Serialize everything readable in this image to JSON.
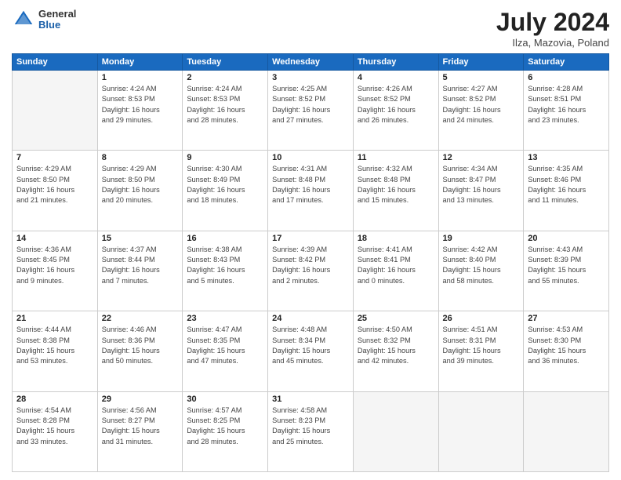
{
  "header": {
    "logo_general": "General",
    "logo_blue": "Blue",
    "title": "July 2024",
    "location": "Ilza, Mazovia, Poland"
  },
  "days_of_week": [
    "Sunday",
    "Monday",
    "Tuesday",
    "Wednesday",
    "Thursday",
    "Friday",
    "Saturday"
  ],
  "weeks": [
    [
      {
        "day": "",
        "info": "",
        "empty": true
      },
      {
        "day": "1",
        "info": "Sunrise: 4:24 AM\nSunset: 8:53 PM\nDaylight: 16 hours\nand 29 minutes."
      },
      {
        "day": "2",
        "info": "Sunrise: 4:24 AM\nSunset: 8:53 PM\nDaylight: 16 hours\nand 28 minutes."
      },
      {
        "day": "3",
        "info": "Sunrise: 4:25 AM\nSunset: 8:52 PM\nDaylight: 16 hours\nand 27 minutes."
      },
      {
        "day": "4",
        "info": "Sunrise: 4:26 AM\nSunset: 8:52 PM\nDaylight: 16 hours\nand 26 minutes."
      },
      {
        "day": "5",
        "info": "Sunrise: 4:27 AM\nSunset: 8:52 PM\nDaylight: 16 hours\nand 24 minutes."
      },
      {
        "day": "6",
        "info": "Sunrise: 4:28 AM\nSunset: 8:51 PM\nDaylight: 16 hours\nand 23 minutes."
      }
    ],
    [
      {
        "day": "7",
        "info": "Sunrise: 4:29 AM\nSunset: 8:50 PM\nDaylight: 16 hours\nand 21 minutes."
      },
      {
        "day": "8",
        "info": "Sunrise: 4:29 AM\nSunset: 8:50 PM\nDaylight: 16 hours\nand 20 minutes."
      },
      {
        "day": "9",
        "info": "Sunrise: 4:30 AM\nSunset: 8:49 PM\nDaylight: 16 hours\nand 18 minutes."
      },
      {
        "day": "10",
        "info": "Sunrise: 4:31 AM\nSunset: 8:48 PM\nDaylight: 16 hours\nand 17 minutes."
      },
      {
        "day": "11",
        "info": "Sunrise: 4:32 AM\nSunset: 8:48 PM\nDaylight: 16 hours\nand 15 minutes."
      },
      {
        "day": "12",
        "info": "Sunrise: 4:34 AM\nSunset: 8:47 PM\nDaylight: 16 hours\nand 13 minutes."
      },
      {
        "day": "13",
        "info": "Sunrise: 4:35 AM\nSunset: 8:46 PM\nDaylight: 16 hours\nand 11 minutes."
      }
    ],
    [
      {
        "day": "14",
        "info": "Sunrise: 4:36 AM\nSunset: 8:45 PM\nDaylight: 16 hours\nand 9 minutes."
      },
      {
        "day": "15",
        "info": "Sunrise: 4:37 AM\nSunset: 8:44 PM\nDaylight: 16 hours\nand 7 minutes."
      },
      {
        "day": "16",
        "info": "Sunrise: 4:38 AM\nSunset: 8:43 PM\nDaylight: 16 hours\nand 5 minutes."
      },
      {
        "day": "17",
        "info": "Sunrise: 4:39 AM\nSunset: 8:42 PM\nDaylight: 16 hours\nand 2 minutes."
      },
      {
        "day": "18",
        "info": "Sunrise: 4:41 AM\nSunset: 8:41 PM\nDaylight: 16 hours\nand 0 minutes."
      },
      {
        "day": "19",
        "info": "Sunrise: 4:42 AM\nSunset: 8:40 PM\nDaylight: 15 hours\nand 58 minutes."
      },
      {
        "day": "20",
        "info": "Sunrise: 4:43 AM\nSunset: 8:39 PM\nDaylight: 15 hours\nand 55 minutes."
      }
    ],
    [
      {
        "day": "21",
        "info": "Sunrise: 4:44 AM\nSunset: 8:38 PM\nDaylight: 15 hours\nand 53 minutes."
      },
      {
        "day": "22",
        "info": "Sunrise: 4:46 AM\nSunset: 8:36 PM\nDaylight: 15 hours\nand 50 minutes."
      },
      {
        "day": "23",
        "info": "Sunrise: 4:47 AM\nSunset: 8:35 PM\nDaylight: 15 hours\nand 47 minutes."
      },
      {
        "day": "24",
        "info": "Sunrise: 4:48 AM\nSunset: 8:34 PM\nDaylight: 15 hours\nand 45 minutes."
      },
      {
        "day": "25",
        "info": "Sunrise: 4:50 AM\nSunset: 8:32 PM\nDaylight: 15 hours\nand 42 minutes."
      },
      {
        "day": "26",
        "info": "Sunrise: 4:51 AM\nSunset: 8:31 PM\nDaylight: 15 hours\nand 39 minutes."
      },
      {
        "day": "27",
        "info": "Sunrise: 4:53 AM\nSunset: 8:30 PM\nDaylight: 15 hours\nand 36 minutes."
      }
    ],
    [
      {
        "day": "28",
        "info": "Sunrise: 4:54 AM\nSunset: 8:28 PM\nDaylight: 15 hours\nand 33 minutes."
      },
      {
        "day": "29",
        "info": "Sunrise: 4:56 AM\nSunset: 8:27 PM\nDaylight: 15 hours\nand 31 minutes."
      },
      {
        "day": "30",
        "info": "Sunrise: 4:57 AM\nSunset: 8:25 PM\nDaylight: 15 hours\nand 28 minutes."
      },
      {
        "day": "31",
        "info": "Sunrise: 4:58 AM\nSunset: 8:23 PM\nDaylight: 15 hours\nand 25 minutes."
      },
      {
        "day": "",
        "info": "",
        "empty": true
      },
      {
        "day": "",
        "info": "",
        "empty": true
      },
      {
        "day": "",
        "info": "",
        "empty": true
      }
    ]
  ]
}
